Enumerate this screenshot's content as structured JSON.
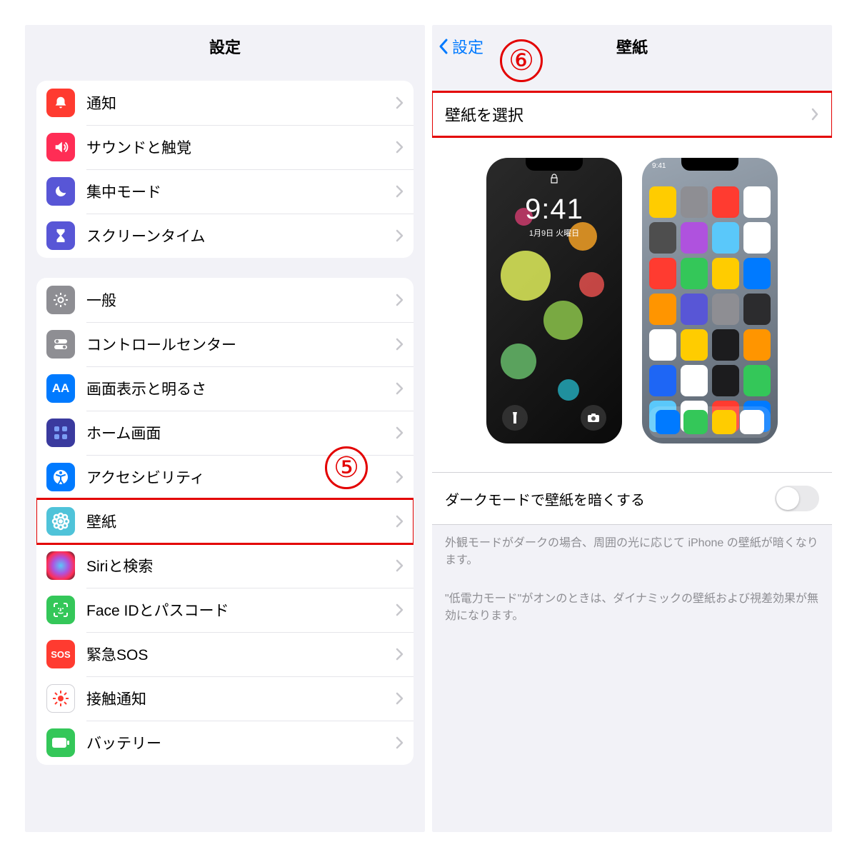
{
  "left": {
    "title": "設定",
    "callout": "⑤",
    "groups": [
      [
        {
          "label": "通知",
          "icon_color": "#ff3b30",
          "icon_name": "bell-icon"
        },
        {
          "label": "サウンドと触覚",
          "icon_color": "#ff2d55",
          "icon_name": "speaker-icon"
        },
        {
          "label": "集中モード",
          "icon_color": "#5856d6",
          "icon_name": "moon-icon"
        },
        {
          "label": "スクリーンタイム",
          "icon_color": "#5856d6",
          "icon_name": "hourglass-icon"
        }
      ],
      [
        {
          "label": "一般",
          "icon_color": "#8e8e93",
          "icon_name": "gear-icon"
        },
        {
          "label": "コントロールセンター",
          "icon_color": "#8e8e93",
          "icon_name": "switches-icon"
        },
        {
          "label": "画面表示と明るさ",
          "icon_color": "#007aff",
          "icon_name": "text-size-icon",
          "icon_text": "AA"
        },
        {
          "label": "ホーム画面",
          "icon_color": "#3a3a9e",
          "icon_name": "grid-icon"
        },
        {
          "label": "アクセシビリティ",
          "icon_color": "#007aff",
          "icon_name": "accessibility-icon"
        },
        {
          "label": "壁紙",
          "icon_color": "#4fc3d9",
          "icon_name": "flower-icon",
          "highlight": true
        },
        {
          "label": "Siriと検索",
          "icon_color": "#2c2c2e",
          "icon_name": "siri-icon",
          "siri": true
        },
        {
          "label": "Face IDとパスコード",
          "icon_color": "#34c759",
          "icon_name": "faceid-icon"
        },
        {
          "label": "緊急SOS",
          "icon_color": "#ff3b30",
          "icon_name": "sos-icon",
          "icon_text": "SOS"
        },
        {
          "label": "接触通知",
          "icon_color": "#ffffff",
          "icon_name": "exposure-icon",
          "exposure": true
        },
        {
          "label": "バッテリー",
          "icon_color": "#34c759",
          "icon_name": "battery-icon"
        }
      ]
    ]
  },
  "right": {
    "back_label": "設定",
    "title": "壁紙",
    "callout": "⑥",
    "select_label": "壁紙を選択",
    "lock_time": "9:41",
    "lock_date": "1月9日 火曜日",
    "dark_toggle_label": "ダークモードで壁紙を暗くする",
    "note1": "外観モードがダークの場合、周囲の光に応じて iPhone の壁紙が暗くなります。",
    "note2": "\"低電力モード\"がオンのときは、ダイナミックの壁紙および視差効果が無効になります。"
  }
}
